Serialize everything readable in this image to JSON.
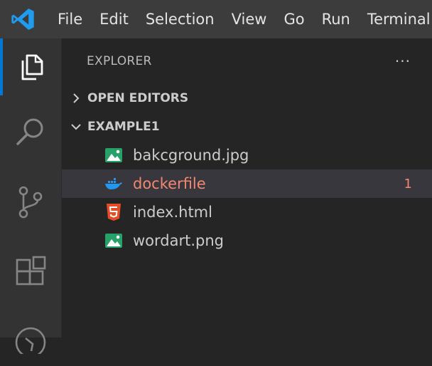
{
  "menu": {
    "items": [
      "File",
      "Edit",
      "Selection",
      "View",
      "Go",
      "Run",
      "Terminal"
    ]
  },
  "activity_bar": {
    "icons": [
      "explorer-icon",
      "search-icon",
      "source-control-icon",
      "extensions-icon",
      "run-debug-icon"
    ]
  },
  "explorer": {
    "title": "EXPLORER",
    "more": "···",
    "sections": {
      "open_editors": "OPEN EDITORS",
      "workspace": "EXAMPLE1"
    },
    "files": [
      {
        "name": "bakcground.jpg",
        "icon": "image-icon",
        "badge": ""
      },
      {
        "name": "dockerfile",
        "icon": "docker-icon",
        "badge": "1"
      },
      {
        "name": "index.html",
        "icon": "html5-icon",
        "badge": ""
      },
      {
        "name": "wordart.png",
        "icon": "image-icon",
        "badge": ""
      }
    ]
  },
  "colors": {
    "accent": "#0078d4",
    "error": "#f48771",
    "image_icon": "#26a269",
    "html_icon": "#e44d26",
    "docker_icon": "#2496ed"
  }
}
